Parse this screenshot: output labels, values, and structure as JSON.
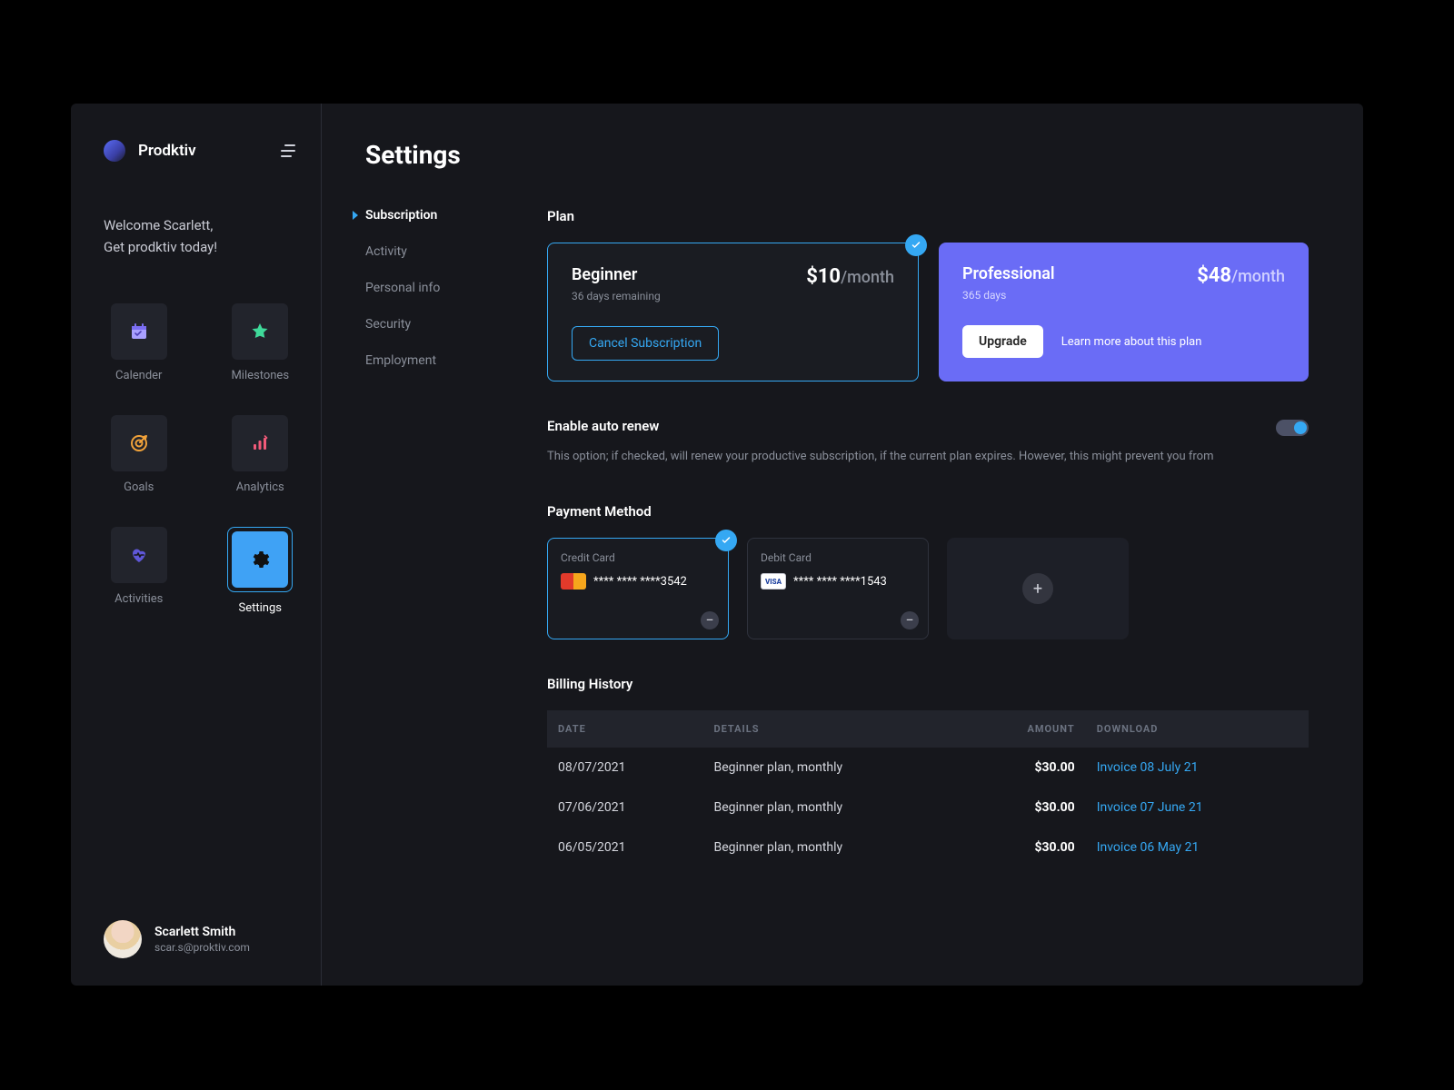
{
  "brand": {
    "name": "Prodktiv"
  },
  "welcome": {
    "line1": "Welcome Scarlett,",
    "line2": "Get prodktiv today!"
  },
  "sidebar": {
    "items": [
      {
        "label": "Calender",
        "icon": "calendar-icon"
      },
      {
        "label": "Milestones",
        "icon": "star-icon"
      },
      {
        "label": "Goals",
        "icon": "target-icon"
      },
      {
        "label": "Analytics",
        "icon": "bars-icon"
      },
      {
        "label": "Activities",
        "icon": "heart-icon"
      },
      {
        "label": "Settings",
        "icon": "gear-icon"
      }
    ]
  },
  "profile": {
    "name": "Scarlett Smith",
    "email": "scar.s@proktiv.com"
  },
  "page": {
    "title": "Settings"
  },
  "subnav": {
    "items": [
      {
        "label": "Subscription"
      },
      {
        "label": "Activity"
      },
      {
        "label": "Personal info"
      },
      {
        "label": "Security"
      },
      {
        "label": "Employment"
      }
    ]
  },
  "plan_section": {
    "title": "Plan"
  },
  "plans": {
    "current": {
      "name": "Beginner",
      "sub": "36 days remaining",
      "price": "$10",
      "period": "/month",
      "cancel_label": "Cancel Subscription"
    },
    "pro": {
      "name": "Professional",
      "sub": "365 days",
      "price": "$48",
      "period": "/month",
      "upgrade_label": "Upgrade",
      "learn_label": "Learn more about this plan"
    }
  },
  "autorenew": {
    "title": "Enable auto renew",
    "desc": "This option; if checked, will renew your productive subscription, if the current plan expires. However, this might prevent you from"
  },
  "payment": {
    "title": "Payment Method",
    "cards": [
      {
        "type": "Credit Card",
        "number": "****  ****  ****3542",
        "brand": "mc"
      },
      {
        "type": "Debit Card",
        "number": "****  ****  ****1543",
        "brand": "visa"
      }
    ]
  },
  "billing": {
    "title": "Billing History",
    "headers": {
      "date": "DATE",
      "details": "DETAILS",
      "amount": "AMOUNT",
      "download": "DOWNLOAD"
    },
    "rows": [
      {
        "date": "08/07/2021",
        "details": "Beginner plan, monthly",
        "amount": "$30.00",
        "download": "Invoice 08 July 21"
      },
      {
        "date": "07/06/2021",
        "details": "Beginner plan, monthly",
        "amount": "$30.00",
        "download": "Invoice 07 June 21"
      },
      {
        "date": "06/05/2021",
        "details": "Beginner plan, monthly",
        "amount": "$30.00",
        "download": "Invoice 06 May 21"
      }
    ]
  }
}
